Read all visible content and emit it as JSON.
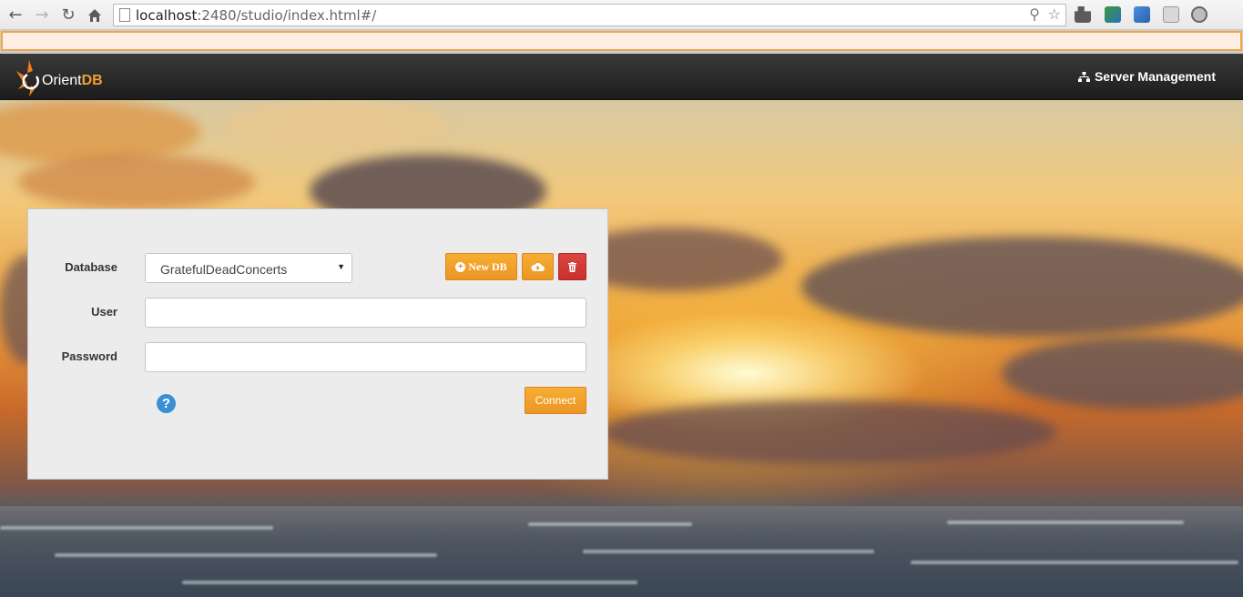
{
  "browser": {
    "url_host": "localhost",
    "url_rest": ":2480/studio/index.html#/",
    "back_icon": "arrow-left-icon",
    "forward_icon": "arrow-right-icon",
    "reload_icon": "reload-icon",
    "home_icon": "home-icon"
  },
  "navbar": {
    "logo_orient": "Orient",
    "logo_db": "DB",
    "server_management": "Server Management"
  },
  "login": {
    "database_label": "Database",
    "database_selected": "GratefulDeadConcerts",
    "user_label": "User",
    "user_value": "",
    "password_label": "Password",
    "password_value": "",
    "new_db_label": "New DB",
    "connect_label": "Connect",
    "help_glyph": "?"
  },
  "colors": {
    "accent_orange": "#ec9524",
    "danger_red": "#c9302c",
    "navbar_dark": "#222222",
    "help_blue": "#3b8fd3"
  }
}
